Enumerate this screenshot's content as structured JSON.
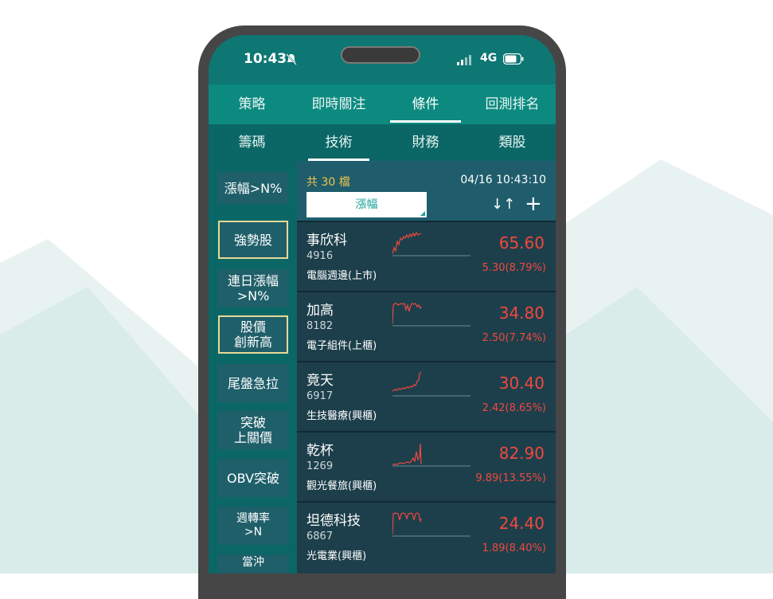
{
  "status_bar": {
    "time": "10:43",
    "network": "4G"
  },
  "tabs_primary": [
    "策略",
    "即時關注",
    "條件",
    "回測排名"
  ],
  "tabs_secondary": [
    "籌碼",
    "技術",
    "財務",
    "類股"
  ],
  "sidebar": [
    {
      "label": "漲幅>N%"
    },
    {
      "label": "強勢股"
    },
    {
      "label": "連日漲幅\n>N%"
    },
    {
      "label": "股價\n創新高"
    },
    {
      "label": "尾盤急拉"
    },
    {
      "label": "突破\n上關價"
    },
    {
      "label": "OBV突破"
    },
    {
      "label": "週轉率\n>N"
    },
    {
      "label": "當沖"
    }
  ],
  "list_header": {
    "count": "共 30 檔",
    "datetime": "04/16 10:43:10",
    "filter": "漲幅",
    "sort_icon": "↓↑",
    "add_icon": "+"
  },
  "stocks": [
    {
      "name": "事欣科",
      "code": "4916",
      "industry": "電腦週邊(上市)",
      "price": "65.60",
      "change": "5.30(8.79%)"
    },
    {
      "name": "加高",
      "code": "8182",
      "industry": "電子組件(上櫃)",
      "price": "34.80",
      "change": "2.50(7.74%)"
    },
    {
      "name": "竟天",
      "code": "6917",
      "industry": "生技醫療(興櫃)",
      "price": "30.40",
      "change": "2.42(8.65%)"
    },
    {
      "name": "乾杯",
      "code": "1269",
      "industry": "觀光餐旅(興櫃)",
      "price": "82.90",
      "change": "9.89(13.55%)"
    },
    {
      "name": "坦德科技",
      "code": "6867",
      "industry": "光電業(興櫃)",
      "price": "24.40",
      "change": "1.89(8.40%)"
    }
  ],
  "colors": {
    "accent": "#0d8a80",
    "up": "#f0483e",
    "count": "#f0c34a"
  }
}
